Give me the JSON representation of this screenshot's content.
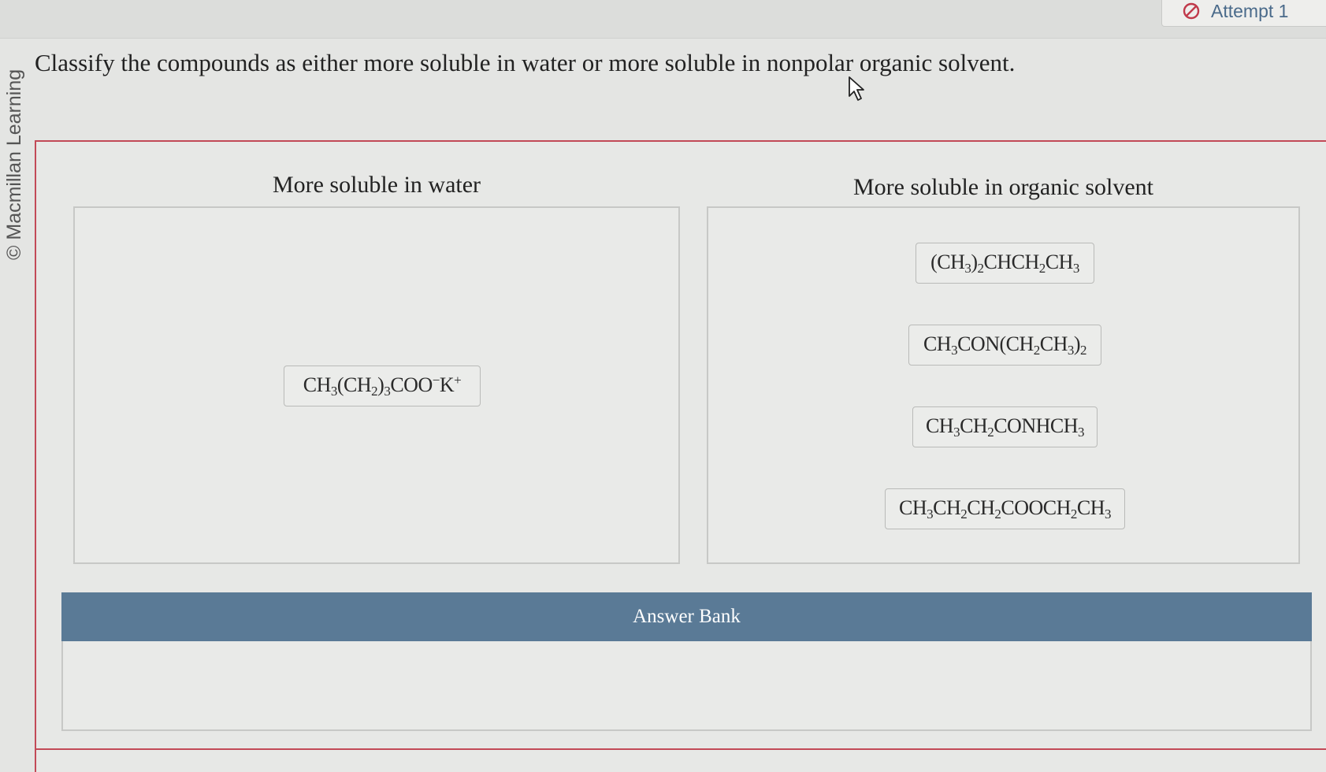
{
  "header": {
    "attempt_label": "Attempt 1",
    "attempt_icon": "prohibited-icon"
  },
  "credit": "© Macmillan Learning",
  "question": "Classify the compounds as either more soluble in water or more soluble in nonpolar organic solvent.",
  "bins": {
    "water": {
      "title": "More soluble in water",
      "items": [
        {
          "label": "CH3(CH2)3COO−K+"
        }
      ]
    },
    "organic": {
      "title": "More soluble in organic solvent",
      "items": [
        {
          "label": "(CH3)2CHCH2CH3"
        },
        {
          "label": "CH3CON(CH2CH3)2"
        },
        {
          "label": "CH3CH2CONHCH3"
        },
        {
          "label": "CH3CH2CH2COOCH2CH3"
        }
      ]
    }
  },
  "answer_bank": {
    "title": "Answer Bank",
    "items": []
  },
  "colors": {
    "accent_red": "#c24a57",
    "bank_header": "#5a7a96",
    "attempt_text": "#4a6a8a"
  }
}
